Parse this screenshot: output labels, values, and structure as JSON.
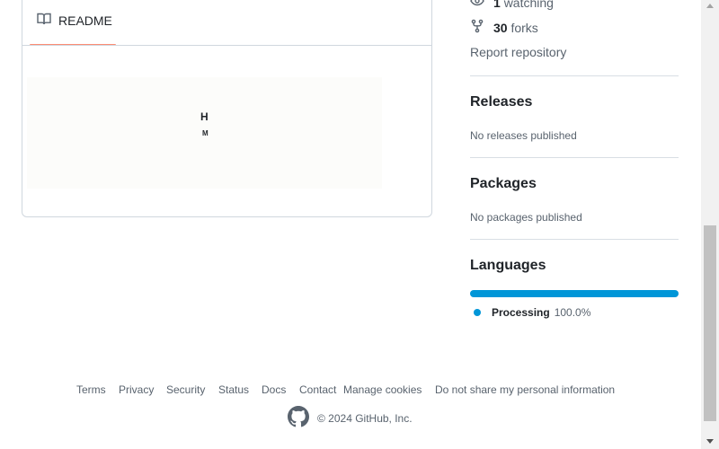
{
  "readme": {
    "tab_label": "README",
    "logo_line1": "H",
    "logo_line2": "M"
  },
  "sidebar": {
    "watching_count": "1",
    "watching_label": "watching",
    "forks_count": "30",
    "forks_label": "forks",
    "report_label": "Report repository",
    "releases": {
      "title": "Releases",
      "note": "No releases published"
    },
    "packages": {
      "title": "Packages",
      "note": "No packages published"
    },
    "languages": {
      "title": "Languages",
      "items": [
        {
          "name": "Processing",
          "percent": "100.0%",
          "color": "#0096d8"
        }
      ]
    }
  },
  "footer": {
    "links": [
      "Terms",
      "Privacy",
      "Security",
      "Status",
      "Docs",
      "Contact",
      "Manage cookies",
      "Do not share my personal information"
    ],
    "copyright": "© 2024 GitHub, Inc."
  },
  "colors": {
    "accent_tab": "#fd8c73",
    "language": "#0096d8",
    "muted": "#59636e"
  }
}
